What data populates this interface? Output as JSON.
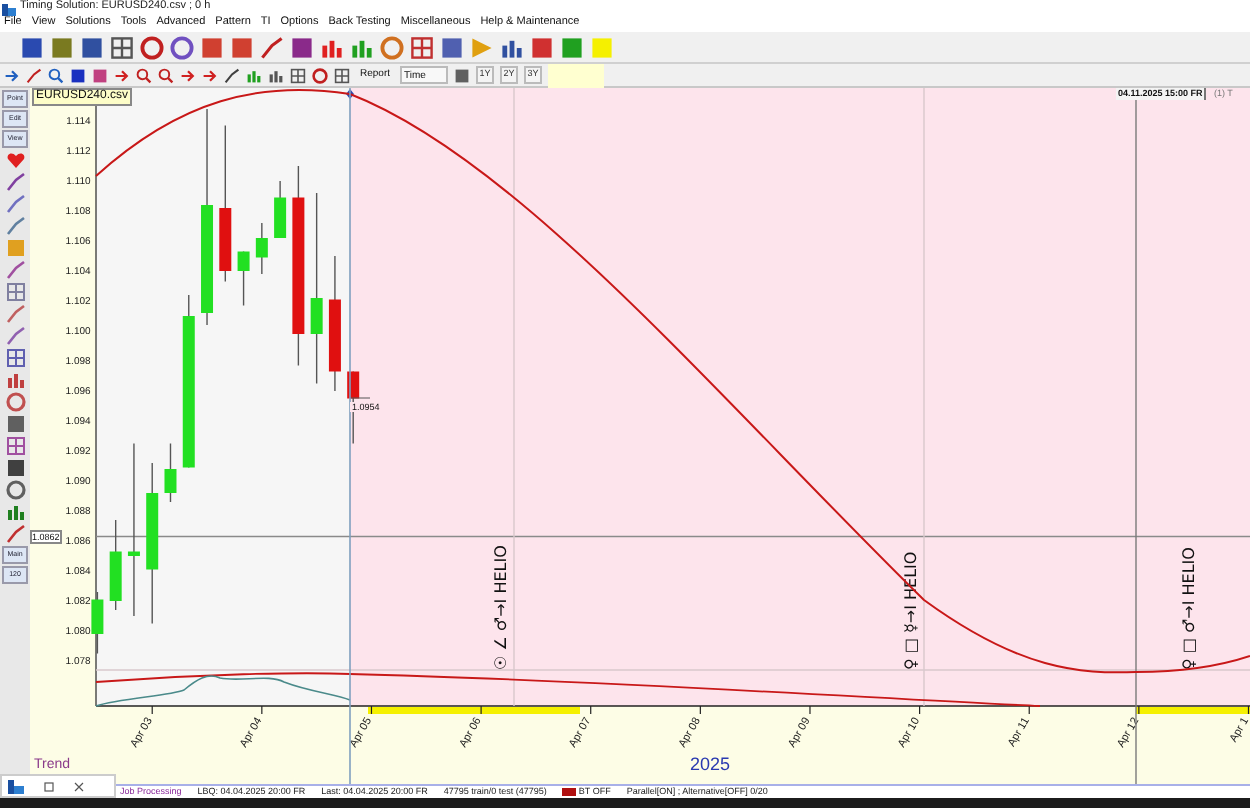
{
  "window": {
    "title": "Timing Solution: EURUSD240.csv ; 0 h"
  },
  "menu": [
    "File",
    "View",
    "Solutions",
    "Tools",
    "Advanced",
    "Pattern",
    "TI",
    "Options",
    "Back Testing",
    "Miscellaneous",
    "Help & Maintenance"
  ],
  "toolbar": {
    "report": "Report",
    "time_dropdown": "Time",
    "range_buttons": [
      "1Y",
      "2Y",
      "3Y"
    ]
  },
  "side_toolbar": [
    "Point",
    "Edit",
    "View",
    "Main",
    "120"
  ],
  "chart": {
    "file_label": "EURUSD240.csv",
    "timestamp": "04.11.2025 15:00 FR",
    "corner_label": "(1) T",
    "chart_data": {
      "type": "candlestick",
      "categories": [
        null,
        null,
        null,
        "Apr 03",
        null,
        null,
        null,
        null,
        null,
        "Apr 04",
        null,
        null,
        null,
        null,
        null,
        "Apr 05",
        null,
        null,
        null,
        null,
        null,
        "Apr 06",
        null,
        null,
        null,
        null,
        null,
        "Apr 07",
        null,
        null,
        null,
        null,
        null,
        "Apr 08",
        null,
        null,
        null,
        null,
        null,
        "Apr 09",
        null,
        null,
        null,
        null,
        null,
        "Apr 10",
        null,
        null,
        null,
        null,
        null,
        "Apr 11",
        null,
        null,
        null,
        null,
        null,
        "Apr 12",
        null,
        null,
        null,
        null,
        null,
        "Apr 1"
      ],
      "ohlc": [
        [
          1.0797,
          1.0825,
          1.0784,
          1.082
        ],
        [
          1.0819,
          1.0873,
          1.0813,
          1.0852
        ],
        [
          1.0849,
          1.0924,
          1.0809,
          1.0852
        ],
        [
          1.084,
          1.0911,
          1.0804,
          1.0891
        ],
        [
          1.0891,
          1.0924,
          1.0885,
          1.0907
        ],
        [
          1.0908,
          1.1023,
          1.0908,
          1.1009
        ],
        [
          1.1011,
          1.1147,
          1.1003,
          1.1083
        ],
        [
          1.1081,
          1.1136,
          1.1032,
          1.1039
        ],
        [
          1.1039,
          1.1052,
          1.1016,
          1.1052
        ],
        [
          1.1048,
          1.1071,
          1.1037,
          1.1061
        ],
        [
          1.1061,
          1.1099,
          1.1061,
          1.1088
        ],
        [
          1.1088,
          1.1109,
          1.0976,
          1.0997
        ],
        [
          1.0997,
          1.1091,
          1.0964,
          1.1021
        ],
        [
          1.102,
          1.1049,
          1.0959,
          1.0972
        ],
        [
          1.0972,
          1.0972,
          1.0924,
          1.0954
        ],
        null,
        null,
        null,
        null,
        null,
        null,
        null,
        null,
        null,
        null,
        null,
        null,
        null,
        null,
        null,
        null,
        null,
        null,
        null,
        null,
        null,
        null,
        null,
        null,
        null,
        null,
        null,
        null,
        null,
        null,
        null,
        null,
        null,
        null,
        null,
        null,
        null,
        null,
        null,
        null,
        null,
        null,
        null,
        null,
        null,
        null,
        null,
        null,
        null
      ],
      "ylim": [
        1.0749,
        1.1161
      ],
      "ref_lines": [
        {
          "axis": "y",
          "value": 1.0862,
          "label": "1.0862"
        }
      ],
      "yticks": [
        {
          "value": 1.114,
          "label": "1.114"
        },
        {
          "value": 1.112,
          "label": "1.112"
        },
        {
          "value": 1.11,
          "label": "1.110"
        },
        {
          "value": 1.108,
          "label": "1.108"
        },
        {
          "value": 1.106,
          "label": "1.106"
        },
        {
          "value": 1.104,
          "label": "1.104"
        },
        {
          "value": 1.102,
          "label": "1.102"
        },
        {
          "value": 1.1,
          "label": "1.100"
        },
        {
          "value": 1.098,
          "label": "1.098"
        },
        {
          "value": 1.096,
          "label": "1.096"
        },
        {
          "value": 1.094,
          "label": "1.094"
        },
        {
          "value": 1.092,
          "label": "1.092"
        },
        {
          "value": 1.09,
          "label": "1.090"
        },
        {
          "value": 1.088,
          "label": "1.088"
        },
        {
          "value": 1.086,
          "label": "1.086"
        },
        {
          "value": 1.084,
          "label": "1.084"
        },
        {
          "value": 1.082,
          "label": "1.082"
        },
        {
          "value": 1.08,
          "label": "1.080"
        },
        {
          "value": 1.078,
          "label": "1.078"
        }
      ]
    },
    "last_price": "1.0954",
    "year": "2025",
    "events": [
      "☉ ∠ ♂→I HELIO",
      "♀ □ ☿→I HELIO",
      "♀ □ ♂→I HELIO"
    ],
    "panel_label": "Trend"
  },
  "status_bar": [
    {
      "text": "Job Processing",
      "kind": "job"
    },
    {
      "text": "LBQ: 04.04.2025 20:00 FR",
      "kind": "plain"
    },
    {
      "text": "Last: 04.04.2025 20:00 FR",
      "kind": "plain"
    },
    {
      "text": "47795 train/0 test (47795)",
      "kind": "plain"
    },
    {
      "text": "BT OFF",
      "kind": "flag",
      "color": "#b01010"
    },
    {
      "text": "Parallel[ON] ; Alternative[OFF] 0/20",
      "kind": "plain"
    }
  ]
}
